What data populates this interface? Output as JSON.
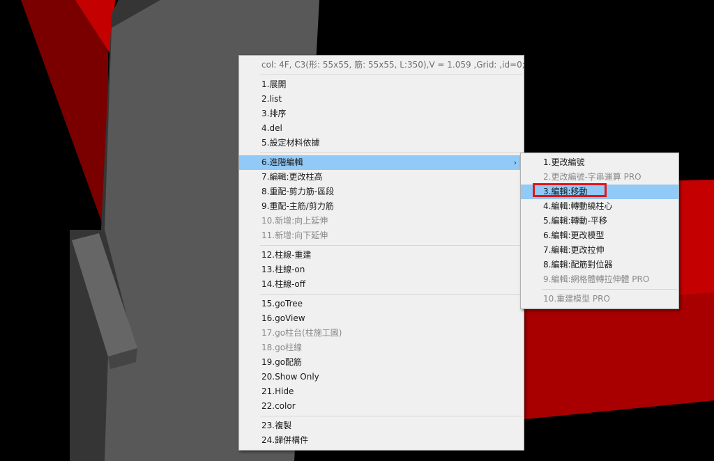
{
  "main_menu": {
    "info": "col: 4F, C3(形: 55x55, 筋: 55x55, L:350),V = 1.059 ,Grid: ,id=0;",
    "group1": [
      "1.展開",
      "2.list",
      "3.排序",
      "4.del",
      "5.設定材料依據"
    ],
    "group2": [
      "6.進階編輯",
      "7.編輯:更改柱高",
      "8.重配-剪力筋-區段",
      "9.重配-主筋/剪力筋",
      "10.新增:向上延伸",
      "11.新增:向下延伸"
    ],
    "group3": [
      "12.柱線-重建",
      "13.柱線-on",
      "14.柱線-off"
    ],
    "group4": [
      "15.goTree",
      "16.goView",
      "17.go柱台(柱施工圖)",
      "18.go柱線",
      "19.go配筋",
      "20.Show Only",
      "21.Hide",
      "22.color"
    ],
    "group5": [
      "23.複製",
      "24.歸併構件"
    ],
    "submenu_arrow": "›"
  },
  "sub_menu": {
    "items": [
      "1.更改編號",
      "2.更改編號-字串運算 PRO",
      "3.編輯:移動",
      "4.編輯:轉動繞柱心",
      "5.編輯:轉動-平移",
      "6.編輯:更改模型",
      "7.編輯:更改拉伸",
      "8.編輯:配筋對位器",
      "9.編輯:網格體轉拉伸體 PRO"
    ],
    "last": "10.重建模型 PRO"
  },
  "colors": {
    "highlight": "#91c9f7",
    "annotation_box": "#e0161b",
    "scene_red": "#c40000"
  }
}
